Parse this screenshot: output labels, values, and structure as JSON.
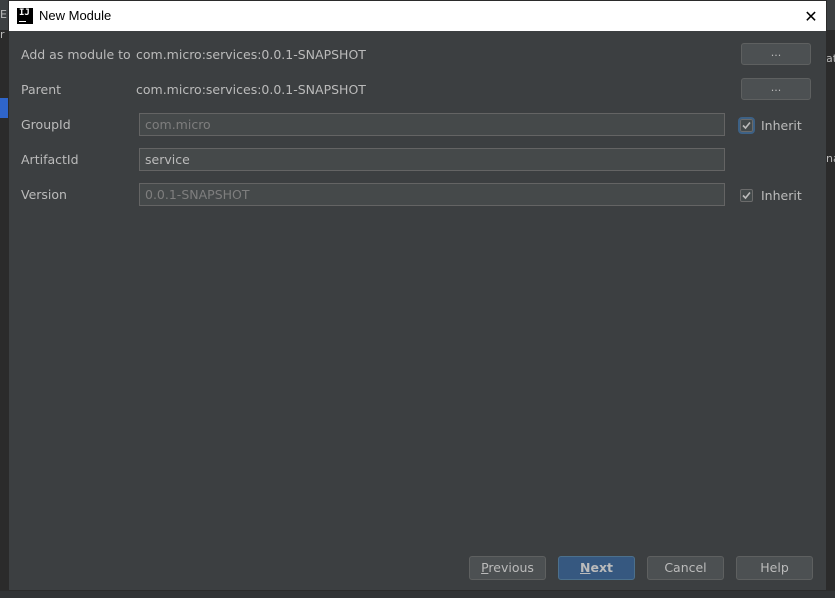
{
  "window": {
    "title": "New Module",
    "close_glyph": "✕"
  },
  "form": {
    "add_as_module_to": {
      "label": "Add as module to",
      "value": "com.micro:services:0.0.1-SNAPSHOT",
      "button_label": "..."
    },
    "parent": {
      "label": "Parent",
      "value": "com.micro:services:0.0.1-SNAPSHOT",
      "button_label": "..."
    },
    "group_id": {
      "label": "GroupId",
      "value": "com.micro",
      "inherit_label": "Inherit",
      "inherit_checked": true
    },
    "artifact_id": {
      "label": "ArtifactId",
      "value": "service"
    },
    "version": {
      "label": "Version",
      "value": "0.0.1-SNAPSHOT",
      "inherit_label": "Inherit",
      "inherit_checked": true
    }
  },
  "buttons": {
    "previous_first": "P",
    "previous_rest": "revious",
    "next_first": "N",
    "next_rest": "ext",
    "cancel": "Cancel",
    "help": "Help"
  },
  "background": {
    "right_fragment_1": "at",
    "right_fragment_2": "na",
    "left_fragment_1": "E",
    "left_fragment_2": "r"
  },
  "colors": {
    "dialog_bg": "#3c3f41",
    "field_bg": "#45494a",
    "primary_button": "#365880",
    "text": "#bbbbbb"
  }
}
